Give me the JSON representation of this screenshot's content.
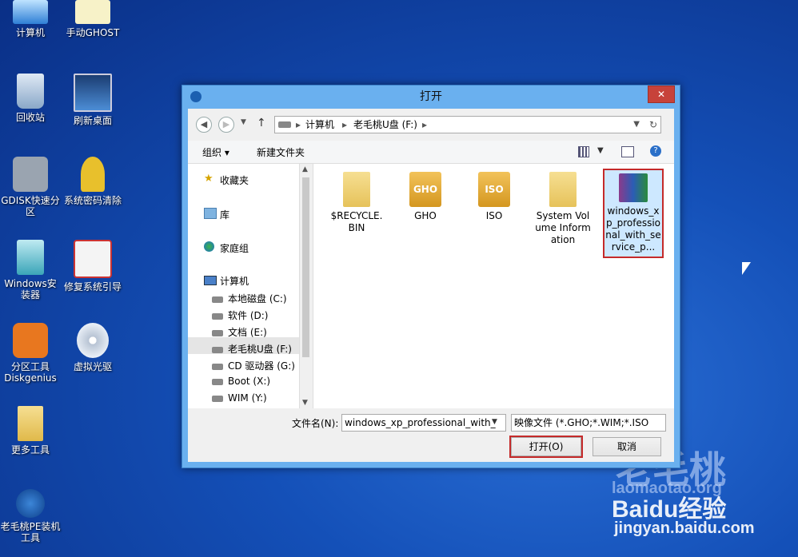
{
  "desktop": {
    "icons": [
      {
        "label": "计算机"
      },
      {
        "label": "手动GHOST"
      },
      {
        "label": "回收站"
      },
      {
        "label": "刷新桌面"
      },
      {
        "label": "GDISK快速分区"
      },
      {
        "label": "系统密码清除"
      },
      {
        "label": "Windows安装器"
      },
      {
        "label": "修复系统引导"
      },
      {
        "label": "分区工具Diskgenius"
      },
      {
        "label": "虚拟光驱"
      },
      {
        "label": "更多工具"
      },
      {
        "label": "老毛桃PE装机工具"
      }
    ],
    "watermarks": [
      "老毛桃",
      "laomaotao.org",
      "Baidu经验",
      "jingyan.baidu.com"
    ]
  },
  "dialog": {
    "title": "打开",
    "close_label": "✕",
    "address": {
      "segments": [
        "计算机",
        "老毛桃U盘 (F:)"
      ]
    },
    "toolbar": {
      "organize": "组织 ▾",
      "new_folder": "新建文件夹"
    },
    "nav": {
      "favorites": "收藏夹",
      "libraries": "库",
      "homegroup": "家庭组",
      "computer": "计算机",
      "drives": [
        "本地磁盘 (C:)",
        "软件 (D:)",
        "文档 (E:)",
        "老毛桃U盘 (F:)",
        "CD 驱动器 (G:)",
        "Boot (X:)",
        "WIM (Y:)"
      ]
    },
    "files": [
      {
        "name": "$RECYCLE.BIN",
        "type": "folder"
      },
      {
        "name": "GHO",
        "type": "drive",
        "badge": "GHO"
      },
      {
        "name": "ISO",
        "type": "drive",
        "badge": "ISO"
      },
      {
        "name": "System Volume Information",
        "type": "folder"
      },
      {
        "name": "windows_xp_professional_with_service_p...",
        "type": "archive"
      }
    ],
    "bottom": {
      "filename_label": "文件名(N):",
      "filename_value": "windows_xp_professional_with_",
      "filter_value": "映像文件 (*.GHO;*.WIM;*.ISO",
      "open_label": "打开(O)",
      "cancel_label": "取消"
    }
  },
  "colors": {
    "accent": "#c52a2a",
    "title_bar": "#6ab0ef"
  }
}
